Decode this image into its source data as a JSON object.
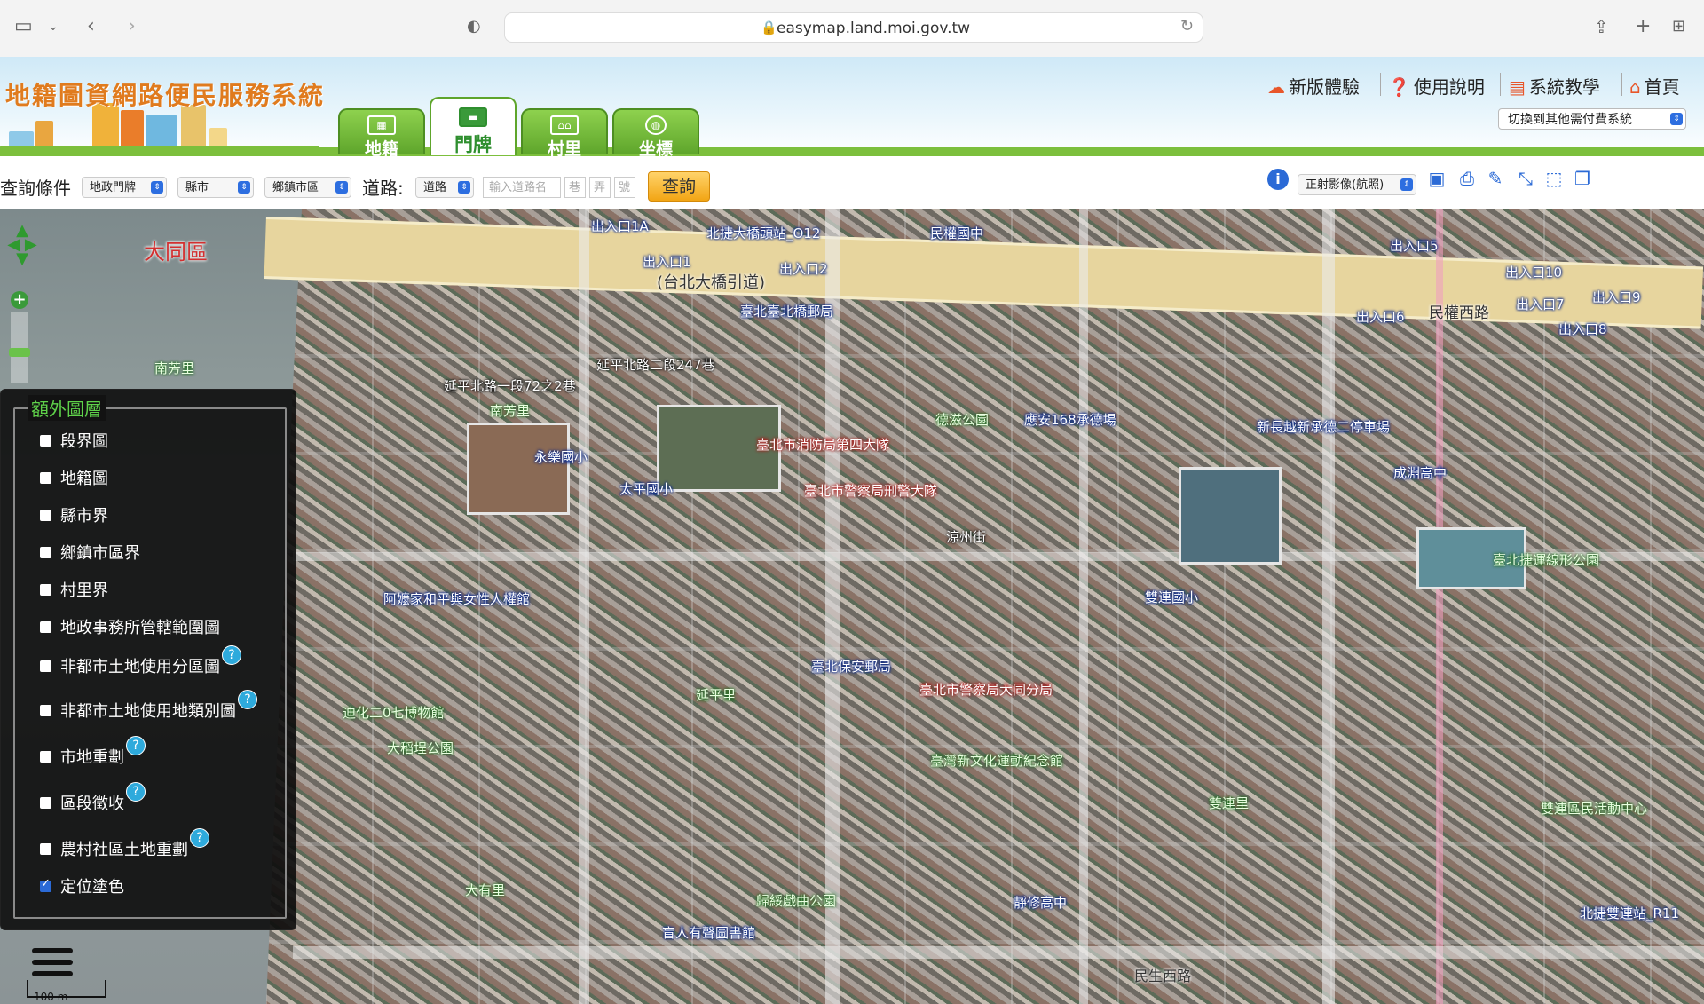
{
  "browser": {
    "url": "easymap.land.moi.gov.tw"
  },
  "site": {
    "title": "地籍圖資網路便民服務系統",
    "tabs": [
      {
        "label": "地籍",
        "active": false
      },
      {
        "label": "門牌",
        "active": true
      },
      {
        "label": "村里",
        "active": false
      },
      {
        "label": "坐標",
        "active": false
      }
    ],
    "top_links": [
      "新版體驗",
      "使用說明",
      "系統教學",
      "首頁"
    ],
    "switch_system": "切換到其他需付費系統"
  },
  "query": {
    "label": "查詢條件",
    "type_select": "地政門牌",
    "county_select": "縣市",
    "town_select": "鄉鎮市區",
    "road_label": "道路:",
    "road_select": "道路",
    "road_input_placeholder": "輸入道路名",
    "lane": "巷",
    "alley": "弄",
    "number": "號",
    "button": "查詢",
    "imagery_select": "正射影像(航照)"
  },
  "layers_panel": {
    "title": "額外圖層",
    "items": [
      {
        "label": "段界圖",
        "checked": false,
        "help": false
      },
      {
        "label": "地籍圖",
        "checked": false,
        "help": false
      },
      {
        "label": "縣市界",
        "checked": false,
        "help": false
      },
      {
        "label": "鄉鎮市區界",
        "checked": false,
        "help": false
      },
      {
        "label": "村里界",
        "checked": false,
        "help": false
      },
      {
        "label": "地政事務所管轄範圍圖",
        "checked": false,
        "help": false
      },
      {
        "label": "非都市土地使用分區圖",
        "checked": false,
        "help": true
      },
      {
        "label": "非都市土地使用地類別圖",
        "checked": false,
        "help": true
      },
      {
        "label": "市地重劃",
        "checked": false,
        "help": true
      },
      {
        "label": "區段徵收",
        "checked": false,
        "help": true
      },
      {
        "label": "農村社區土地重劃",
        "checked": false,
        "help": true
      },
      {
        "label": "定位塗色",
        "checked": true,
        "help": false
      }
    ]
  },
  "map": {
    "scale": "100 m",
    "labels": {
      "district": "大同區",
      "nanfang1": "南芳里",
      "nanfang2": "南芳里",
      "bridge": "(台北大橋引道)",
      "exit1a": "出入口1A",
      "exit1": "出入口1",
      "exit2": "出入口2",
      "exit5": "出入口5",
      "exit6": "出入口6",
      "exit10": "出入口10",
      "exit7": "出入口7",
      "exit9": "出入口9",
      "exit8": "出入口8",
      "station": "北捷大橋頭站_O12",
      "minquan_mid": "民權國中",
      "minquan_rd": "民權西路",
      "yanping": "延平北路一段72之2巷",
      "yanping2": "延平北路二段247巷",
      "yongle": "永樂國小",
      "taiping": "太平國小",
      "fire": "臺北市消防局第四大隊",
      "police": "臺北市警察局刑警大隊",
      "dejian": "德滋公園",
      "parking168": "應安168承德場",
      "chengde": "新長越新承德二停車場",
      "chengyuan": "成淵高中",
      "shuanglian": "雙連國小",
      "peace": "阿嬤家和平與女性人權館",
      "post": "臺北保安郵局",
      "dadaocheng": "大稻埕公園",
      "police_datong": "臺北市警察局大同分局",
      "culture": "臺灣新文化運動紀念館",
      "jingxiu": "靜修高中",
      "shuanglianli": "雙連里",
      "minsheng": "民生西路",
      "mrt": "北捷雙連站_R11",
      "yanping_li": "延平里",
      "youyou": "迪化二0七博物館",
      "guisui": "歸綏戲曲公園",
      "blind": "盲人有聲圖書館",
      "post_north": "臺北臺北橋郵局",
      "daye": "大有里",
      "shuanglian_center": "雙連區民活動中心",
      "park_linear": "臺北捷運線形公園",
      "liangzhou": "涼州街"
    }
  }
}
